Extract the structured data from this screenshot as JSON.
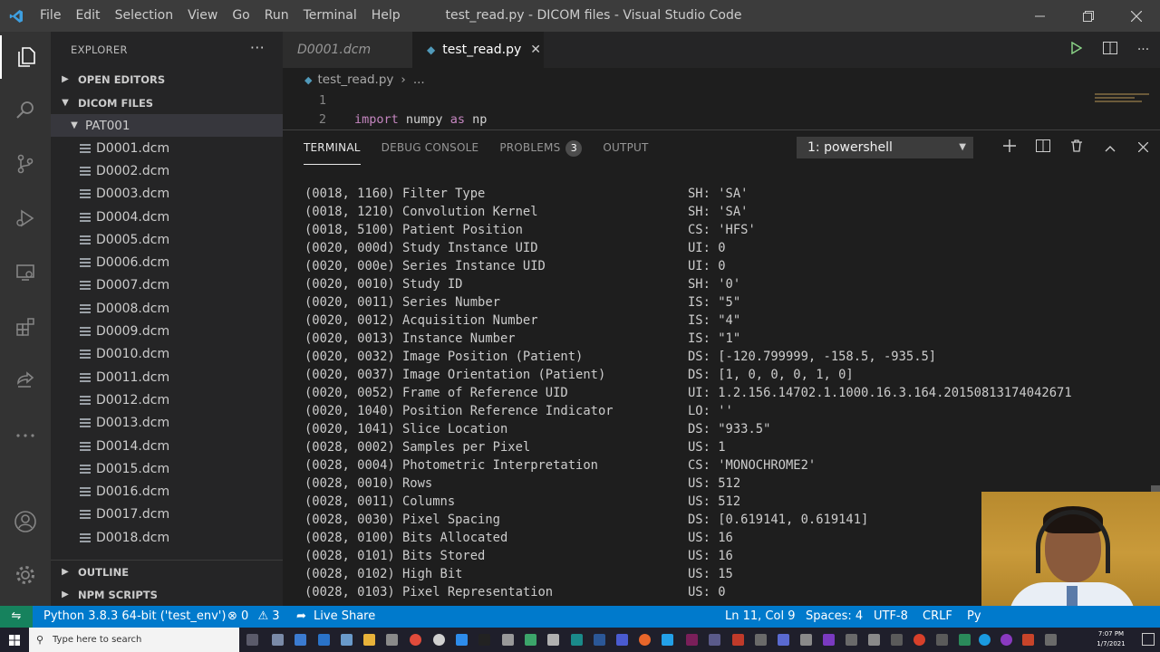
{
  "window": {
    "title": "test_read.py - DICOM files - Visual Studio Code",
    "menu": [
      "File",
      "Edit",
      "Selection",
      "View",
      "Go",
      "Run",
      "Terminal",
      "Help"
    ]
  },
  "sidebar": {
    "header": "EXPLORER",
    "open_editors": "OPEN EDITORS",
    "workspace": "DICOM FILES",
    "folder": "PAT001",
    "files": [
      "D0001.dcm",
      "D0002.dcm",
      "D0003.dcm",
      "D0004.dcm",
      "D0005.dcm",
      "D0006.dcm",
      "D0007.dcm",
      "D0008.dcm",
      "D0009.dcm",
      "D0010.dcm",
      "D0011.dcm",
      "D0012.dcm",
      "D0013.dcm",
      "D0014.dcm",
      "D0015.dcm",
      "D0016.dcm",
      "D0017.dcm",
      "D0018.dcm"
    ],
    "outline": "OUTLINE",
    "npm_scripts": "NPM SCRIPTS"
  },
  "tabs": [
    {
      "label": "D0001.dcm",
      "active": false
    },
    {
      "label": "test_read.py",
      "active": true
    }
  ],
  "breadcrumb": {
    "file": "test_read.py",
    "rest": "..."
  },
  "editor": {
    "lines": [
      {
        "num": "1",
        "code": ""
      },
      {
        "num": "2",
        "keyword": "import",
        "code": " numpy ",
        "keyword2": "as",
        "code2": " np"
      }
    ]
  },
  "panel": {
    "tabs": [
      "TERMINAL",
      "DEBUG CONSOLE",
      "PROBLEMS",
      "OUTPUT"
    ],
    "problems_count": "3",
    "terminal_select": "1: powershell",
    "lines": [
      {
        "tag": "(0018, 1160) Filter Type",
        "val": "SH: 'SA'"
      },
      {
        "tag": "(0018, 1210) Convolution Kernel",
        "val": "SH: 'SA'"
      },
      {
        "tag": "(0018, 5100) Patient Position",
        "val": "CS: 'HFS'"
      },
      {
        "tag": "(0020, 000d) Study Instance UID",
        "val": "UI: 0"
      },
      {
        "tag": "(0020, 000e) Series Instance UID",
        "val": "UI: 0"
      },
      {
        "tag": "(0020, 0010) Study ID",
        "val": "SH: '0'"
      },
      {
        "tag": "(0020, 0011) Series Number",
        "val": "IS: \"5\""
      },
      {
        "tag": "(0020, 0012) Acquisition Number",
        "val": "IS: \"4\""
      },
      {
        "tag": "(0020, 0013) Instance Number",
        "val": "IS: \"1\""
      },
      {
        "tag": "(0020, 0032) Image Position (Patient)",
        "val": "DS: [-120.799999, -158.5, -935.5]"
      },
      {
        "tag": "(0020, 0037) Image Orientation (Patient)",
        "val": "DS: [1, 0, 0, 0, 1, 0]"
      },
      {
        "tag": "(0020, 0052) Frame of Reference UID",
        "val": "UI: 1.2.156.14702.1.1000.16.3.164.20150813174042671"
      },
      {
        "tag": "(0020, 1040) Position Reference Indicator",
        "val": "LO: ''"
      },
      {
        "tag": "(0020, 1041) Slice Location",
        "val": "DS: \"933.5\""
      },
      {
        "tag": "(0028, 0002) Samples per Pixel",
        "val": "US: 1"
      },
      {
        "tag": "(0028, 0004) Photometric Interpretation",
        "val": "CS: 'MONOCHROME2'"
      },
      {
        "tag": "(0028, 0010) Rows",
        "val": "US: 512"
      },
      {
        "tag": "(0028, 0011) Columns",
        "val": "US: 512"
      },
      {
        "tag": "(0028, 0030) Pixel Spacing",
        "val": "DS: [0.619141, 0.619141]"
      },
      {
        "tag": "(0028, 0100) Bits Allocated",
        "val": "US: 16"
      },
      {
        "tag": "(0028, 0101) Bits Stored",
        "val": "US: 16"
      },
      {
        "tag": "(0028, 0102) High Bit",
        "val": "US: 15"
      },
      {
        "tag": "(0028, 0103) Pixel Representation",
        "val": "US: 0"
      }
    ]
  },
  "statusbar": {
    "interpreter": "Python 3.8.3 64-bit ('test_env')",
    "errors": "0",
    "warnings": "3",
    "live_share": "Live Share",
    "position": "Ln 11, Col 9",
    "spaces": "Spaces: 4",
    "encoding": "UTF-8",
    "eol": "CRLF",
    "language": "Py"
  },
  "taskbar": {
    "search_placeholder": "Type here to search",
    "time": "7:07 PM",
    "date": "1/7/2021"
  },
  "colors": {
    "statusbar": "#007acc",
    "activitybar": "#333333",
    "sidebar": "#252526",
    "editor": "#1e1e1e"
  }
}
